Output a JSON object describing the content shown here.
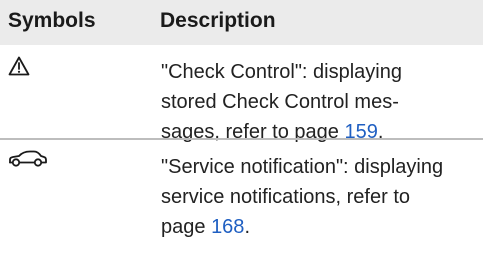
{
  "header": {
    "symbols_label": "Symbols",
    "description_label": "Description"
  },
  "rows": [
    {
      "icon": "warning-triangle-icon",
      "lines": [
        "\"Check Control\": displaying",
        "stored Check Control mes-",
        "sages, refer to page "
      ],
      "page_ref": "159",
      "suffix": "."
    },
    {
      "icon": "car-icon",
      "lines": [
        "\"Service notification\": displaying",
        "service notifications, refer to",
        "page "
      ],
      "page_ref": "168",
      "suffix": "."
    }
  ],
  "colors": {
    "header_bg": "#ebebeb",
    "link": "#1f5fc2",
    "divider": "#bdbdbd"
  }
}
